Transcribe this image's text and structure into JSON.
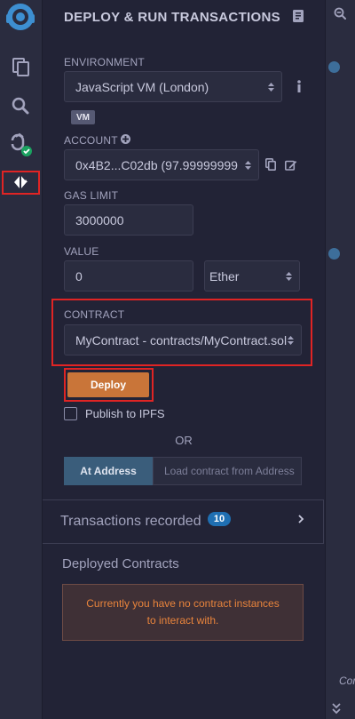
{
  "panel": {
    "title": "DEPLOY & RUN TRANSACTIONS"
  },
  "environment": {
    "label": "ENVIRONMENT",
    "value": "JavaScript VM (London)",
    "badge": "VM"
  },
  "account": {
    "label": "ACCOUNT",
    "value": "0x4B2...C02db (97.99999999"
  },
  "gas_limit": {
    "label": "GAS LIMIT",
    "value": "3000000"
  },
  "value": {
    "label": "VALUE",
    "amount": "0",
    "unit": "Ether"
  },
  "contract": {
    "label": "CONTRACT",
    "value": "MyContract - contracts/MyContract.sol"
  },
  "actions": {
    "deploy_label": "Deploy",
    "publish_label": "Publish to IPFS",
    "or_label": "OR",
    "at_address_label": "At Address",
    "at_address_placeholder": "Load contract from Address"
  },
  "transactions": {
    "title": "Transactions recorded",
    "count": "10"
  },
  "deployed": {
    "title": "Deployed Contracts",
    "empty_message": "Currently you have no contract instances to interact with."
  },
  "editor_strip": {
    "partial_text": "Con"
  },
  "colors": {
    "accent": "#c97539",
    "highlight": "#e02424",
    "badge": "#1f6fb2",
    "success": "#1aa260"
  }
}
